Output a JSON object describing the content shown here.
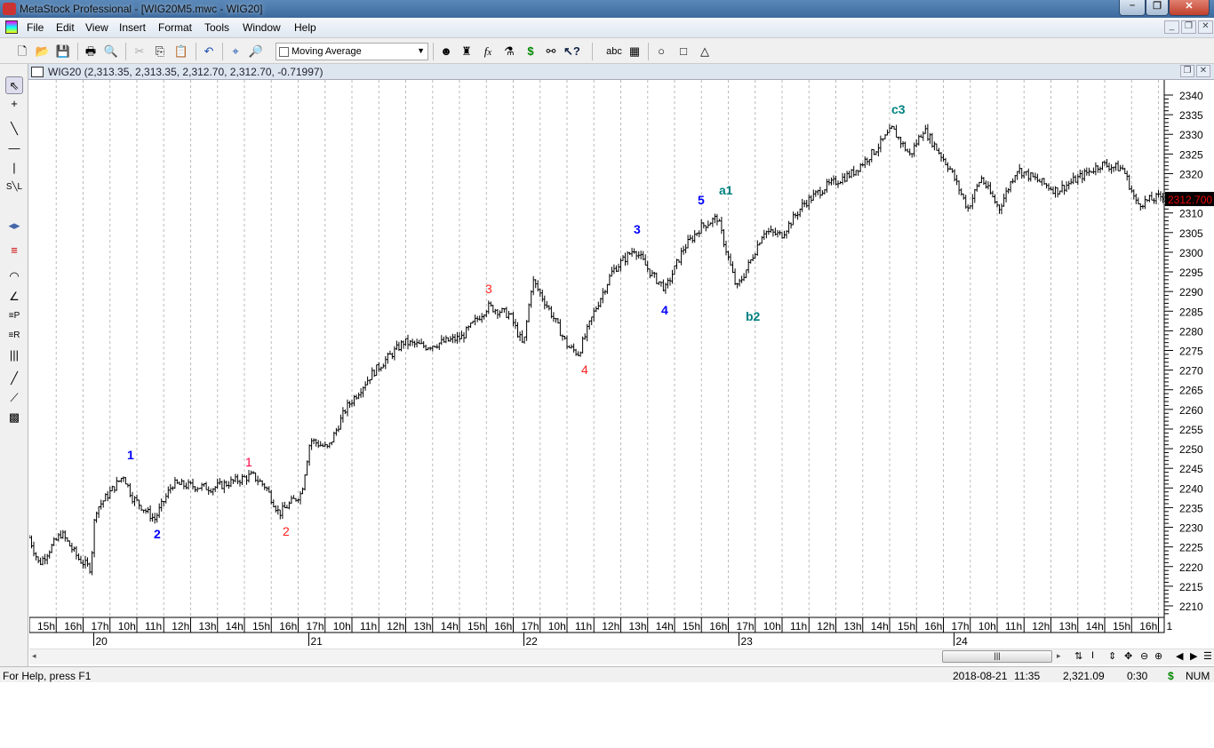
{
  "app": {
    "title": "MetaStock Professional - [WIG20M5.mwc - WIG20]"
  },
  "menu": [
    "File",
    "Edit",
    "View",
    "Insert",
    "Format",
    "Tools",
    "Window",
    "Help"
  ],
  "toolbar": {
    "indicator_select": "Moving Average",
    "text_tool": "abc"
  },
  "chart_window": {
    "title": "WIG20 (2,313.35, 2,313.35, 2,312.70, 2,312.70, -0.71997)",
    "last_price": "2312.700"
  },
  "y_axis": {
    "ticks": [
      "2340",
      "2335",
      "2330",
      "2325",
      "2320",
      "2315",
      "2310",
      "2305",
      "2300",
      "2295",
      "2290",
      "2285",
      "2280",
      "2275",
      "2270",
      "2265",
      "2260",
      "2255",
      "2250",
      "2245",
      "2240",
      "2235",
      "2230",
      "2225",
      "2220",
      "2215",
      "2210"
    ]
  },
  "x_axis": {
    "hours": [
      "15h",
      "16h",
      "17h",
      "10h",
      "11h",
      "12h",
      "13h",
      "14h",
      "15h",
      "16h",
      "17h",
      "10h",
      "11h",
      "12h",
      "13h",
      "14h",
      "15h",
      "16h",
      "17h",
      "10h",
      "11h",
      "12h",
      "13h",
      "14h",
      "15h",
      "16h",
      "17h",
      "10h",
      "11h",
      "12h",
      "13h",
      "14h",
      "15h",
      "16h",
      "17h",
      "10h",
      "11h",
      "12h",
      "13h",
      "14h",
      "15h",
      "16h",
      "1"
    ],
    "days": [
      "20",
      "21",
      "22",
      "23",
      "24"
    ]
  },
  "price_keypoints": [
    [
      0,
      2227.4
    ],
    [
      0.36,
      2220.6
    ],
    [
      1.19,
      2228.5
    ],
    [
      1.85,
      2221.8
    ],
    [
      2.28,
      2219.5
    ],
    [
      2.45,
      2234.2
    ],
    [
      3.5,
      2243.2
    ],
    [
      3.83,
      2237.6
    ],
    [
      4.66,
      2232
    ],
    [
      5.32,
      2241
    ],
    [
      6.81,
      2240
    ],
    [
      8.3,
      2243.2
    ],
    [
      8.79,
      2240.3
    ],
    [
      9.29,
      2233.5
    ],
    [
      10.12,
      2238.7
    ],
    [
      10.45,
      2252.3
    ],
    [
      11.11,
      2250
    ],
    [
      11.77,
      2260.2
    ],
    [
      12.76,
      2269.2
    ],
    [
      13.92,
      2277.1
    ],
    [
      14.74,
      2276
    ],
    [
      16.07,
      2278.3
    ],
    [
      17.06,
      2286.2
    ],
    [
      17.88,
      2284
    ],
    [
      18.38,
      2276
    ],
    [
      18.71,
      2293
    ],
    [
      19.37,
      2285
    ],
    [
      20.03,
      2276
    ],
    [
      20.43,
      2274.2
    ],
    [
      21.02,
      2285
    ],
    [
      21.69,
      2295.2
    ],
    [
      22.51,
      2300.9
    ],
    [
      23.17,
      2294.1
    ],
    [
      23.67,
      2290.7
    ],
    [
      24.33,
      2300.9
    ],
    [
      24.99,
      2306.5
    ],
    [
      25.59,
      2308.8
    ],
    [
      26.31,
      2290.7
    ],
    [
      26.81,
      2297.5
    ],
    [
      27.31,
      2305.4
    ],
    [
      27.97,
      2304.3
    ],
    [
      28.79,
      2312.2
    ],
    [
      29.62,
      2316.7
    ],
    [
      30.61,
      2320.1
    ],
    [
      31.44,
      2325.8
    ],
    [
      32.1,
      2331.4
    ],
    [
      32.76,
      2324.6
    ],
    [
      33.26,
      2331.4
    ],
    [
      34.25,
      2321.2
    ],
    [
      34.91,
      2311.1
    ],
    [
      35.4,
      2319
    ],
    [
      36.07,
      2311.1
    ],
    [
      36.73,
      2321.2
    ],
    [
      38.21,
      2315.6
    ],
    [
      39.87,
      2322.4
    ],
    [
      40.69,
      2321.2
    ],
    [
      41.19,
      2312.2
    ],
    [
      42.18,
      2314.4
    ]
  ],
  "wave_labels": [
    {
      "text": "1",
      "color": "#0000ff"
    },
    {
      "text": "2",
      "color": "#0000ff"
    },
    {
      "text": "1",
      "color": "#ff0040"
    },
    {
      "text": "2",
      "color": "#ff2020"
    },
    {
      "text": "3",
      "color": "#ff2020"
    },
    {
      "text": "4",
      "color": "#ff2020"
    },
    {
      "text": "3",
      "color": "#0000ff"
    },
    {
      "text": "4",
      "color": "#0000ff"
    },
    {
      "text": "5",
      "color": "#0000ff"
    },
    {
      "text": "a1",
      "color": "#008080"
    },
    {
      "text": "b2",
      "color": "#008080"
    },
    {
      "text": "c3",
      "color": "#008080"
    }
  ],
  "status": {
    "help": "For Help, press F1",
    "date": "2018-08-21",
    "time": "11:35",
    "value": "2,321.09",
    "interval": "0:30",
    "currency": "$",
    "num": "NUM"
  }
}
